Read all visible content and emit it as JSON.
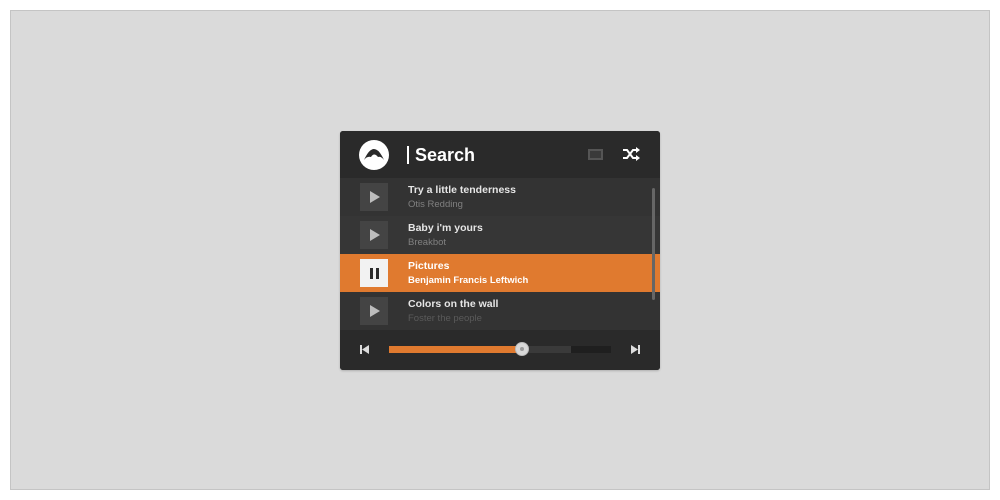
{
  "header": {
    "title": "Search",
    "logo_icon": "grooveshark-logo",
    "screen_icon": "monitor-icon",
    "shuffle_icon": "shuffle-icon"
  },
  "playlist": [
    {
      "song": "Try a little tenderness",
      "artist": "Otis Redding",
      "state": "play"
    },
    {
      "song": "Baby i'm yours",
      "artist": "Breakbot",
      "state": "play"
    },
    {
      "song": "Pictures",
      "artist": "Benjamin Francis Leftwich",
      "state": "pause"
    },
    {
      "song": "Colors on the wall",
      "artist": "Foster the people",
      "state": "play"
    }
  ],
  "progress": {
    "played_percent": 60,
    "buffered_percent": 82
  },
  "colors": {
    "accent": "#e07a2f",
    "panel": "#2b2b2b",
    "background": "#dadada"
  }
}
